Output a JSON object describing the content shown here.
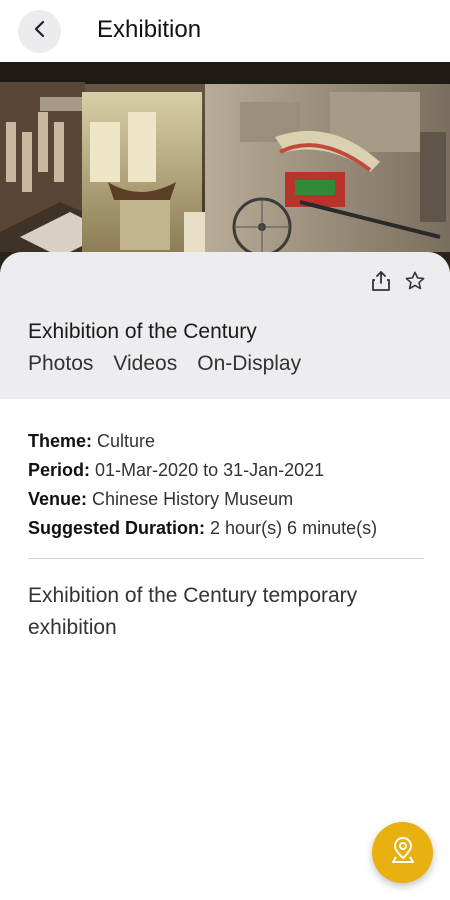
{
  "header": {
    "title": "Exhibition",
    "back_icon": "chevron-left-icon"
  },
  "hero": {
    "icon": "exhibition-photo"
  },
  "card": {
    "share_icon": "share-icon",
    "favorite_icon": "star-outline-icon",
    "title": "Exhibition of the Century",
    "tabs": [
      "Photos",
      "Videos",
      "On-Display"
    ]
  },
  "details": {
    "theme_label": "Theme:",
    "theme_value": "Culture",
    "period_label": "Period:",
    "period_value": "01-Mar-2020 to 31-Jan-2021",
    "venue_label": "Venue:",
    "venue_value": "Chinese History Museum",
    "duration_label": "Suggested Duration:",
    "duration_value": "2 hour(s) 6 minute(s)"
  },
  "description": "Exhibition of the Century temporary exhibition",
  "fab": {
    "icon": "map-pin-icon",
    "color": "#e9b10f"
  }
}
